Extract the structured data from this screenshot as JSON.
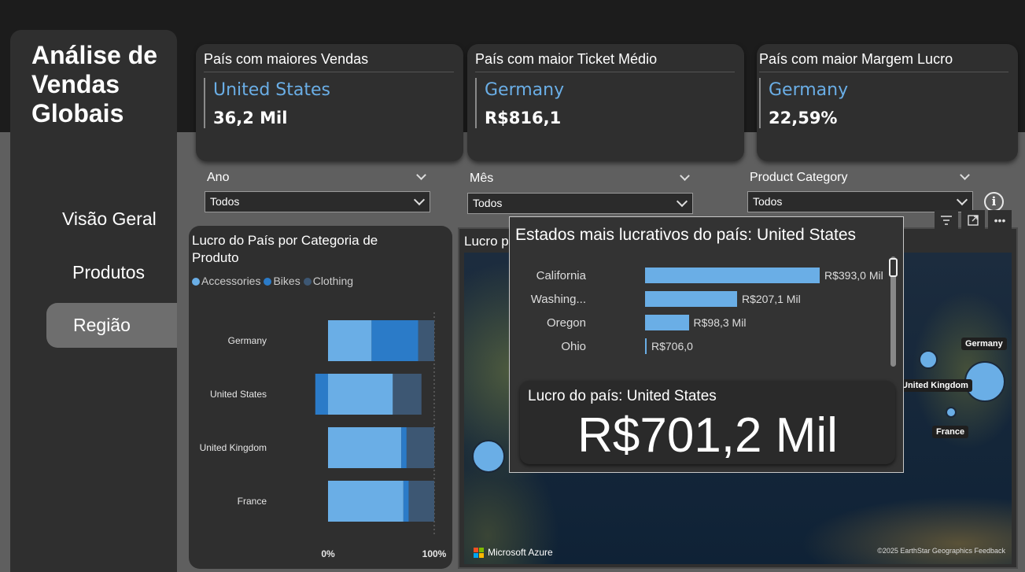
{
  "app": {
    "title": "Análise de Vendas Globais"
  },
  "nav": {
    "items": [
      "Visão Geral",
      "Produtos",
      "Região"
    ],
    "active": "Região"
  },
  "kpis": [
    {
      "title": "País com maiores Vendas",
      "country": "United States",
      "value": "36,2 Mil"
    },
    {
      "title": "País com maior Ticket Médio",
      "country": "Germany",
      "value": "R$816,1"
    },
    {
      "title": "País com maior Margem Lucro",
      "country": "Germany",
      "value": "22,59%"
    }
  ],
  "slicers": [
    {
      "label": "Ano",
      "selected": "Todos"
    },
    {
      "label": "Mês",
      "selected": "Todos"
    },
    {
      "label": "Product Category",
      "selected": "Todos"
    }
  ],
  "bar_chart": {
    "title": "Lucro do País por Categoria de Produto",
    "legend": [
      "Accessories",
      "Bikes",
      "Clothing"
    ],
    "axis_start": "0%",
    "axis_end": "100%"
  },
  "chart_data": {
    "type": "bar",
    "stacked": "100%",
    "orientation": "horizontal",
    "categories": [
      "Germany",
      "United States",
      "United Kingdom",
      "France"
    ],
    "series": [
      {
        "name": "Accessories",
        "values": [
          41,
          61,
          69,
          71
        ]
      },
      {
        "name": "Bikes",
        "values": [
          44,
          -12,
          5,
          5
        ]
      },
      {
        "name": "Clothing",
        "values": [
          15,
          27,
          26,
          24
        ]
      }
    ],
    "xlim": [
      -12,
      100
    ],
    "colors": [
      "#6aaee6",
      "#2b7bc8",
      "#3d5773"
    ],
    "legend_position": "top-left"
  },
  "map": {
    "title": "Lucro p",
    "labels": [
      "Germany",
      "United Kingdom",
      "France"
    ],
    "brand": "Microsoft Azure",
    "credit": "©2025 EarthStar Geographics  Feedback"
  },
  "tooltip": {
    "title": "Estados mais lucrativos do país: United States",
    "states": [
      {
        "name": "California",
        "value": 393.0,
        "label": "R$393,0 Mil"
      },
      {
        "name": "Washing...",
        "value": 207.1,
        "label": "R$207,1 Mil"
      },
      {
        "name": "Oregon",
        "value": 98.3,
        "label": "R$98,3 Mil"
      },
      {
        "name": "Ohio",
        "value": 0.706,
        "label": "R$706,0"
      }
    ],
    "card_title": "Lucro do país: United States",
    "card_value": "R$701,2 Mil"
  },
  "colors": {
    "accent": "#6aaee6",
    "panel": "#2f2f2f",
    "header": "#1c1c1c",
    "background": "#5f5f5f"
  }
}
